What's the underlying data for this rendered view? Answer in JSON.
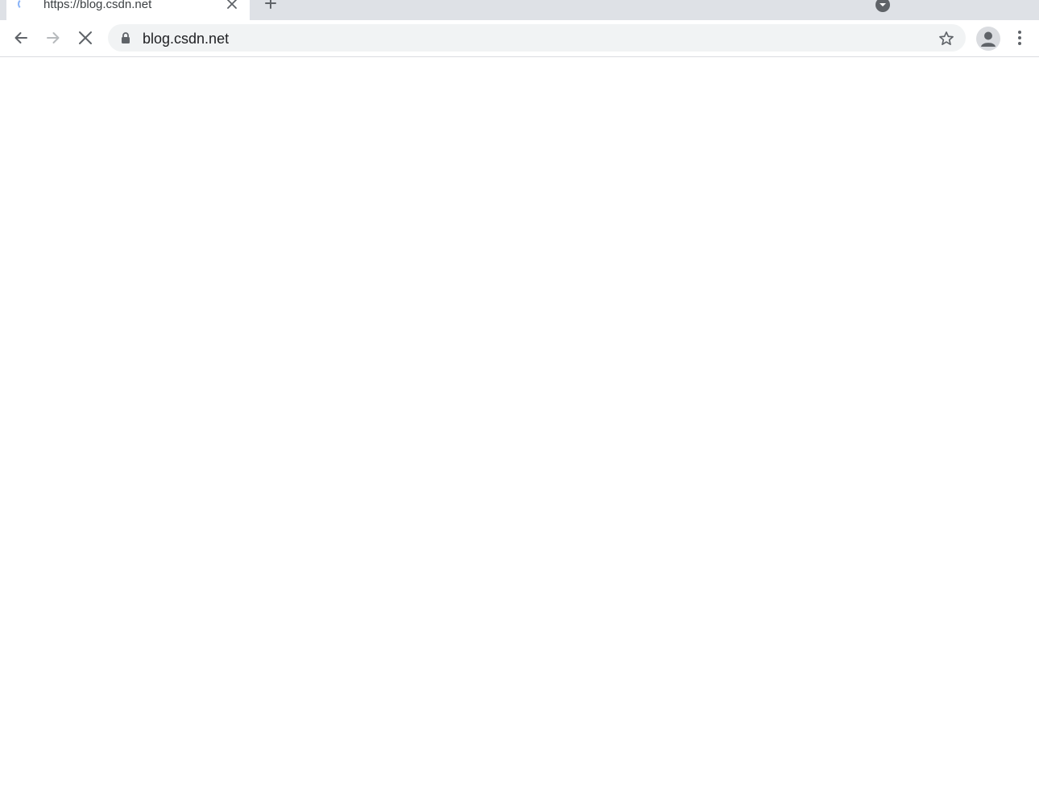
{
  "tab": {
    "title": "https://blog.csdn.net",
    "loading": true,
    "spinner_color": "#8ab4f8"
  },
  "toolbar": {
    "back_icon": "arrow-left-icon",
    "forward_icon": "arrow-right-icon",
    "stop_icon": "close-icon"
  },
  "omnibox": {
    "url": "blog.csdn.net",
    "secure_icon": "lock-icon",
    "bookmark_icon": "star-icon"
  },
  "colors": {
    "tabstrip_bg": "#dee1e6",
    "omnibox_bg": "#f1f3f4",
    "icon": "#5f6368",
    "forward_disabled": "#b7babd",
    "text": "#202124"
  }
}
